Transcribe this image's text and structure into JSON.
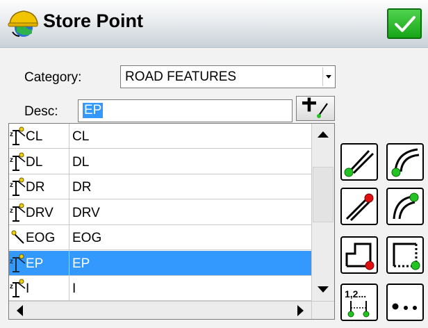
{
  "window": {
    "title": "Store Point",
    "ok_icon": "checkmark-icon",
    "app_icon": "hardhat-globe-icon"
  },
  "form": {
    "category_label": "Category:",
    "category_value": "ROAD FEATURES",
    "desc_label": "Desc:",
    "desc_value": "EP"
  },
  "list": {
    "rows": [
      {
        "code": "CL",
        "desc": "CL",
        "icon": "elevation-point-icon",
        "selected": false
      },
      {
        "code": "DL",
        "desc": "DL",
        "icon": "elevation-point-icon",
        "selected": false
      },
      {
        "code": "DR",
        "desc": "DR",
        "icon": "elevation-point-icon",
        "selected": false
      },
      {
        "code": "DRV",
        "desc": "DRV",
        "icon": "elevation-point-icon",
        "selected": false
      },
      {
        "code": "EOG",
        "desc": "EOG",
        "icon": "line-point-icon",
        "selected": false
      },
      {
        "code": "EP",
        "desc": "EP",
        "icon": "elevation-point-icon",
        "selected": true
      },
      {
        "code": "I",
        "desc": "I",
        "icon": "elevation-point-icon",
        "selected": false
      }
    ]
  },
  "tools": [
    {
      "name": "line-start-icon"
    },
    {
      "name": "arc-start-icon"
    },
    {
      "name": "line-end-icon"
    },
    {
      "name": "arc-end-icon"
    },
    {
      "name": "close-rectangle-icon"
    },
    {
      "name": "complete-rectangle-icon"
    },
    {
      "name": "point-sequence-icon",
      "label": "1,2..."
    },
    {
      "name": "more-options-icon"
    }
  ],
  "colors": {
    "selection": "#3399ff",
    "ok_green": "#22b422",
    "point_green": "#22c322",
    "point_red": "#e01010"
  }
}
